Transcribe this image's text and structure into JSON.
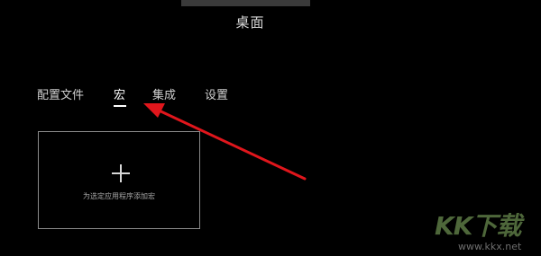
{
  "window": {
    "title": "桌面"
  },
  "tabs": [
    {
      "label": "配置文件",
      "active": false
    },
    {
      "label": "宏",
      "active": true
    },
    {
      "label": "集成",
      "active": false
    },
    {
      "label": "设置",
      "active": false
    }
  ],
  "macro_card": {
    "icon": "plus-icon",
    "label": "为选定应用程序添加宏"
  },
  "annotation": {
    "arrow_color": "#e0161c"
  },
  "watermark": {
    "brand": "KK下载",
    "url": "www.kkx.net"
  },
  "colors": {
    "background": "#000000",
    "accent": "#ffffff"
  }
}
